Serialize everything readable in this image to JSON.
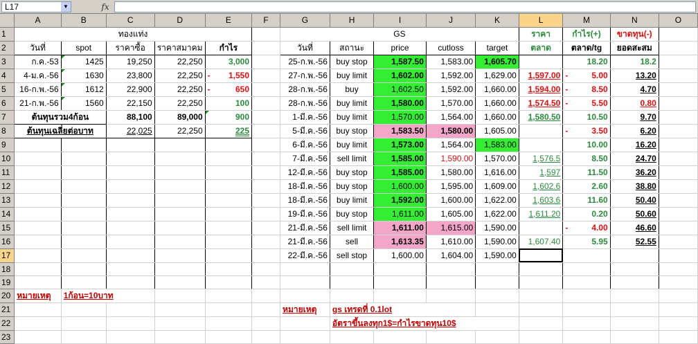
{
  "formula_bar": {
    "name_box": "L17",
    "fx": "fx"
  },
  "columns": [
    "",
    "A",
    "B",
    "C",
    "D",
    "E",
    "F",
    "G",
    "H",
    "I",
    "J",
    "K",
    "L",
    "M",
    "N",
    "O"
  ],
  "rows": [
    "1",
    "2",
    "3",
    "4",
    "5",
    "6",
    "7",
    "8",
    "9",
    "10",
    "11",
    "12",
    "13",
    "14",
    "15",
    "16",
    "17",
    "18",
    "19",
    "20",
    "21",
    "22",
    "23"
  ],
  "left": {
    "title": "ทองแท่ง",
    "headers": [
      "วันที่",
      "spot",
      "ราคาซื้อ",
      "ราคาสมาคม",
      "กำไร"
    ],
    "data": [
      {
        "date": "ก.ค.-53",
        "spot": "1425",
        "buy": "19,250",
        "assoc": "22,250",
        "profit": "3,000",
        "pref": ""
      },
      {
        "date": "4-ม.ค.-56",
        "spot": "1630",
        "buy": "23,800",
        "assoc": "22,250",
        "profit": "1,550",
        "pref": "-"
      },
      {
        "date": "16-ก.พ.-56",
        "spot": "1612",
        "buy": "22,900",
        "assoc": "22,250",
        "profit": "650",
        "pref": "-"
      },
      {
        "date": "21-ก.พ.-56",
        "spot": "1560",
        "buy": "22,150",
        "assoc": "22,250",
        "profit": "100",
        "pref": ""
      }
    ],
    "total_label": "ต้นทุนรวม4ก้อน",
    "total_buy": "88,100",
    "total_assoc": "89,000",
    "total_profit": "900",
    "avg_label": "ต้นทุนเฉลี่ยต่อบาท",
    "avg_buy": "22,025",
    "avg_assoc": "22,250",
    "avg_profit": "225",
    "note_label": "หมายเหตุ",
    "note_text": "1ก้อน=10บาท"
  },
  "right": {
    "title": "GS",
    "l1": "ราคา",
    "m1": "กำไร(+)",
    "n1": "ขาดทุน(-)",
    "headers": [
      "วันที่",
      "สถานะ",
      "price",
      "cutloss",
      "target",
      "ตลาด",
      "ตลาด/tg",
      "ยอดสะสม"
    ],
    "data": [
      {
        "date": "25-ก.พ.-56",
        "status": "buy stop",
        "price": "1,587.50",
        "cut": "1,583.00",
        "target": "1,605.70",
        "market": "",
        "pl": "18.20",
        "plpref": "",
        "cum": "18.2"
      },
      {
        "date": "27-ก.พ.-56",
        "status": "buy limit",
        "price": "1,602.00",
        "cut": "1,592.00",
        "target": "1,629.00",
        "market": "1,597.00",
        "pl": "5.00",
        "plpref": "-",
        "cum": "13.20"
      },
      {
        "date": "28-ก.พ.-56",
        "status": "buy",
        "price": "1,602.50",
        "cut": "1,592.00",
        "target": "1,660.00",
        "market": "1,594.00",
        "pl": "8.50",
        "plpref": "-",
        "cum": "4.70"
      },
      {
        "date": "28-ก.พ.-56",
        "status": "buy limit",
        "price": "1,580.00",
        "cut": "1,570.00",
        "target": "1,660.00",
        "market": "1,574.50",
        "pl": "5.50",
        "plpref": "-",
        "cum": "0.80"
      },
      {
        "date": "1-มี.ค.-56",
        "status": "buy limit",
        "price": "1,570.00",
        "cut": "1,564.00",
        "target": "1,660.00",
        "market": "1,580.50",
        "pl": "10.50",
        "plpref": "",
        "cum": "9.70"
      },
      {
        "date": "5-มี.ค.-56",
        "status": "buy stop",
        "price": "1,583.50",
        "cut": "1,580.00",
        "target": "1,605.00",
        "market": "",
        "pl": "3.50",
        "plpref": "-",
        "cum": "6.20"
      },
      {
        "date": "6-มี.ค.-56",
        "status": "buy limit",
        "price": "1,573.00",
        "cut": "1,564.00",
        "target": "1,583.00",
        "market": "",
        "pl": "10.00",
        "plpref": "",
        "cum": "16.20"
      },
      {
        "date": "7-มี.ค.-56",
        "status": "sell limit",
        "price": "1,585.00",
        "cut": "1,590.00",
        "target": "1,570.00",
        "market": "1,576.5",
        "pl": "8.50",
        "plpref": "",
        "cum": "24.70"
      },
      {
        "date": "12-มี.ค.-56",
        "status": "buy stop",
        "price": "1,585.00",
        "cut": "1,580.00",
        "target": "1,616.00",
        "market": "1,597",
        "pl": "11.50",
        "plpref": "",
        "cum": "36.20"
      },
      {
        "date": "18-มี.ค.-56",
        "status": "buy stop",
        "price": "1,600.00",
        "cut": "1,595.00",
        "target": "1,609.00",
        "market": "1,602.6",
        "pl": "2.60",
        "plpref": "",
        "cum": "38.80"
      },
      {
        "date": "18-มี.ค.-56",
        "status": "buy limit",
        "price": "1,592.00",
        "cut": "1,600.00",
        "target": "1,622.00",
        "market": "1,603.6",
        "pl": "11.60",
        "plpref": "",
        "cum": "50.40"
      },
      {
        "date": "19-มี.ค.-56",
        "status": "buy stop",
        "price": "1,611.00",
        "cut": "1,605.00",
        "target": "1,622.00",
        "market": "1,611.20",
        "pl": "0.20",
        "plpref": "",
        "cum": "50.60"
      },
      {
        "date": "21-มี.ค.-56",
        "status": "sell limit",
        "price": "1,611.00",
        "cut": "1,615.00",
        "target": "1,590.00",
        "market": "",
        "pl": "4.00",
        "plpref": "-",
        "cum": "46.60"
      },
      {
        "date": "21-มี.ค.-56",
        "status": "sell",
        "price": "1,613.35",
        "cut": "1,610.00",
        "target": "1,590.00",
        "market": "1,607.40",
        "pl": "5.95",
        "plpref": "",
        "cum": "52.55"
      },
      {
        "date": "22-มี.ค.-56",
        "status": "sell stop",
        "price": "1,600.00",
        "cut": "1,604.00",
        "target": "1,590.00",
        "market": "",
        "pl": "",
        "plpref": "",
        "cum": ""
      }
    ],
    "note_label": "หมายเหตุ",
    "note_text": "gs เทรดที่ 0.1lot",
    "note_text2": "อัตราขึ้นลงทุก1$=กำไรขาดทุน10$"
  },
  "colors": {
    "green": "#33ee33",
    "pink": "#f4a6c8",
    "text_green": "#2c8a3c",
    "text_red": "#e01010",
    "header_bg": "#d4d0c8"
  }
}
